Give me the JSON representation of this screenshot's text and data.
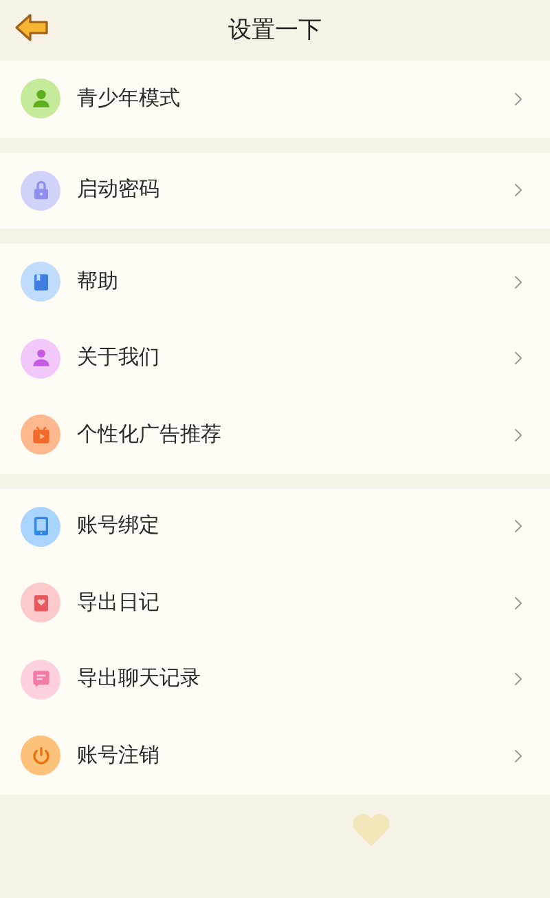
{
  "header": {
    "title": "设置一下"
  },
  "groups": [
    {
      "items": [
        {
          "label": "青少年模式",
          "color": "#c4ea9a"
        }
      ]
    },
    {
      "items": [
        {
          "label": "启动密码",
          "color": "#d0d2fa"
        }
      ]
    },
    {
      "items": [
        {
          "label": "帮助",
          "color": "#bfdcfd"
        },
        {
          "label": "关于我们",
          "color": "#f2c8fb"
        },
        {
          "label": "个性化广告推荐",
          "color": "#fdb98d"
        }
      ]
    },
    {
      "items": [
        {
          "label": "账号绑定",
          "color": "#a9d4fd"
        },
        {
          "label": "导出日记",
          "color": "#fccacb"
        },
        {
          "label": "导出聊天记录",
          "color": "#fcd0dc"
        },
        {
          "label": "账号注销",
          "color": "#fdc279"
        }
      ]
    }
  ]
}
